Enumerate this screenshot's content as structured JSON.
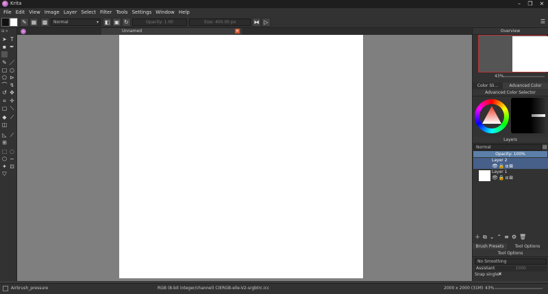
{
  "window": {
    "title": "Krita",
    "min_glyph": "–",
    "max_glyph": "❐",
    "close_glyph": "✕"
  },
  "menu": [
    "File",
    "Edit",
    "View",
    "Image",
    "Layer",
    "Select",
    "Filter",
    "Tools",
    "Settings",
    "Window",
    "Help"
  ],
  "toolbar": {
    "blend_mode": "Normal",
    "opacity_label": "Opacity: 1.00",
    "size_label": "Size: 400.00 px"
  },
  "document": {
    "tab_title": "Unnamed",
    "close_glyph": "✕"
  },
  "overview": {
    "title": "Overview",
    "zoom": "43%"
  },
  "color_panel": {
    "tabs": [
      "Color Sli...",
      "Advanced Color Sele..."
    ],
    "title": "Advanced Color Selector"
  },
  "layers": {
    "title": "Layers",
    "blend_mode": "Normal",
    "opacity_label": "Opacity:  100%",
    "items": [
      {
        "name": "Layer 2",
        "selected": true
      },
      {
        "name": "Layer 1",
        "selected": false
      }
    ]
  },
  "bottom_tabs": [
    "Brush Presets",
    "Tool Options"
  ],
  "tool_options": {
    "title": "Tool Options",
    "smoothing": "No Smoothing",
    "assistant_label": "Assistant",
    "assistant_value": "1000",
    "snap_label": "Snap single:"
  },
  "status": {
    "brush": "Airbrush_pressure",
    "color_space": "RGB (8-bit integer/channel)  CIERGB-elle-V2-srgbtrc.icc",
    "dimensions": "2000 x 2000 (31M)",
    "zoom": "43%"
  },
  "colors": {
    "accent": "#5b7fa8",
    "canvas_bg": "#7f7f7f",
    "close_tab": "#d9532a"
  }
}
